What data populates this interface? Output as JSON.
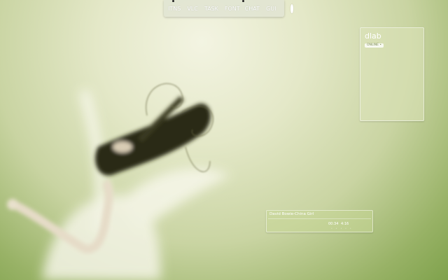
{
  "launcher": {
    "items": [
      "ITNS",
      "VLC",
      "TASK",
      "FONT",
      "CHAT",
      "GUI"
    ],
    "end_icon": "circle-icon"
  },
  "contact": {
    "name": "dlab",
    "status": "ONLINE •"
  },
  "player": {
    "track": "David Bowie-China Girl",
    "elapsed": "00:34",
    "total": "4:16",
    "controls": "• • • • •"
  },
  "colors": {
    "bg_light": "#f3f4e2",
    "bg_green": "#7fa24c",
    "hair": "#2a2a18"
  }
}
